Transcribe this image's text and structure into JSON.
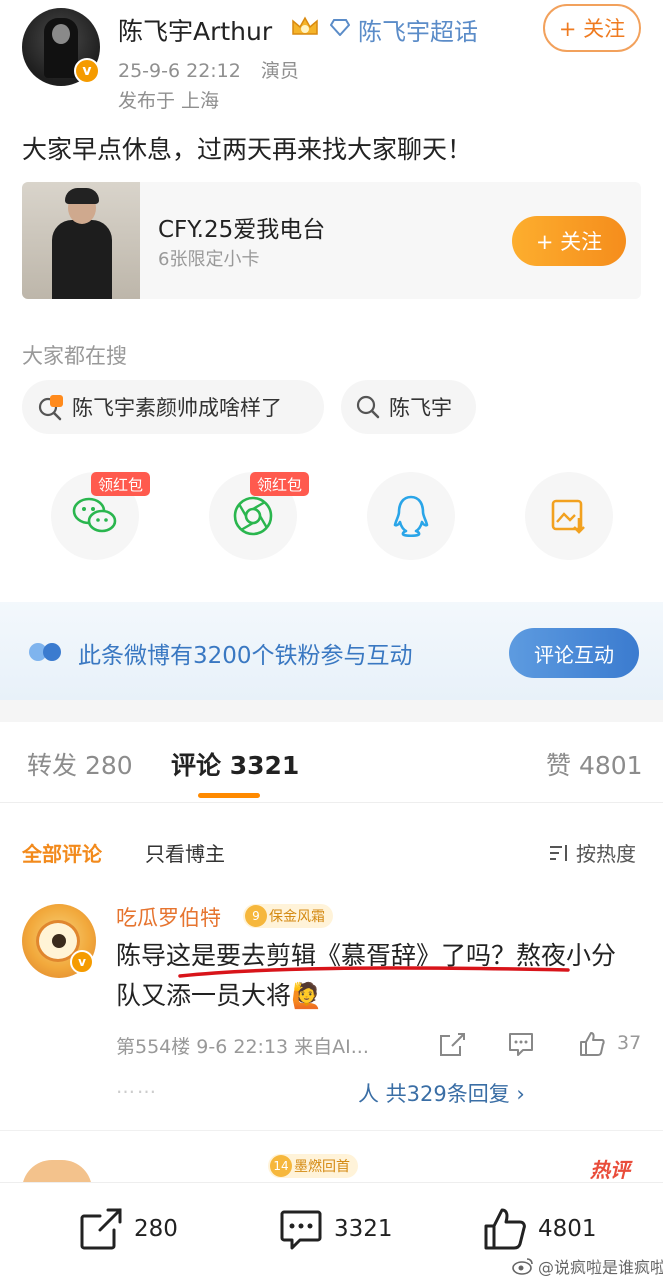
{
  "post": {
    "author": "陈飞宇Arthur",
    "supertopic": "陈飞宇超话",
    "follow_label": "+ 关注",
    "date": "25-9-6 22:12",
    "role": "演员",
    "location": "发布于 上海",
    "text": "大家早点休息，过两天再来找大家聊天！",
    "verify_mark": "v"
  },
  "card": {
    "title": "CFY.25爱我电台",
    "subtitle": "6张限定小卡",
    "follow_label": "+ 关注"
  },
  "search": {
    "heading": "大家都在搜",
    "chips": [
      {
        "label": "陈飞宇素颜帅成啥样了",
        "icon": "hot-search-icon"
      },
      {
        "label": "陈飞宇",
        "icon": "search-icon"
      }
    ]
  },
  "share": {
    "red_tag_1": "领红包",
    "red_tag_2": "领红包",
    "targets": [
      "wechat-icon",
      "moments-icon",
      "qq-icon",
      "save-image-icon"
    ]
  },
  "banner": {
    "text": "此条微博有3200个铁粉参与互动",
    "button": "评论互动"
  },
  "tabs": {
    "repost": "转发 280",
    "comment": "评论 3321",
    "like": "赞 4801"
  },
  "filters": {
    "all": "全部评论",
    "author_only": "只看博主",
    "sort": "按热度"
  },
  "comment": {
    "name": "吃瓜罗伯特",
    "badge_level": "9",
    "badge_text": "保金风霜",
    "text": "陈导这是要去剪辑《慕胥辞》了吗？熬夜小分队又添一员大将🙋",
    "meta": "第554楼  9-6 22:13  来自AI...",
    "likes": "37",
    "dots": "……",
    "replies": "人 共329条回复 ›"
  },
  "next_comment": {
    "badge_level": "14",
    "badge_text": "墨燃回首",
    "hot_tag": "热评"
  },
  "bottom": {
    "repost": "280",
    "comment": "3321",
    "like": "4801"
  },
  "watermark": "@说疯啦是谁疯啦",
  "colors": {
    "accent_orange": "#f28a1c",
    "link_blue": "#3a78c2",
    "red_tag": "#ff5a4e"
  }
}
